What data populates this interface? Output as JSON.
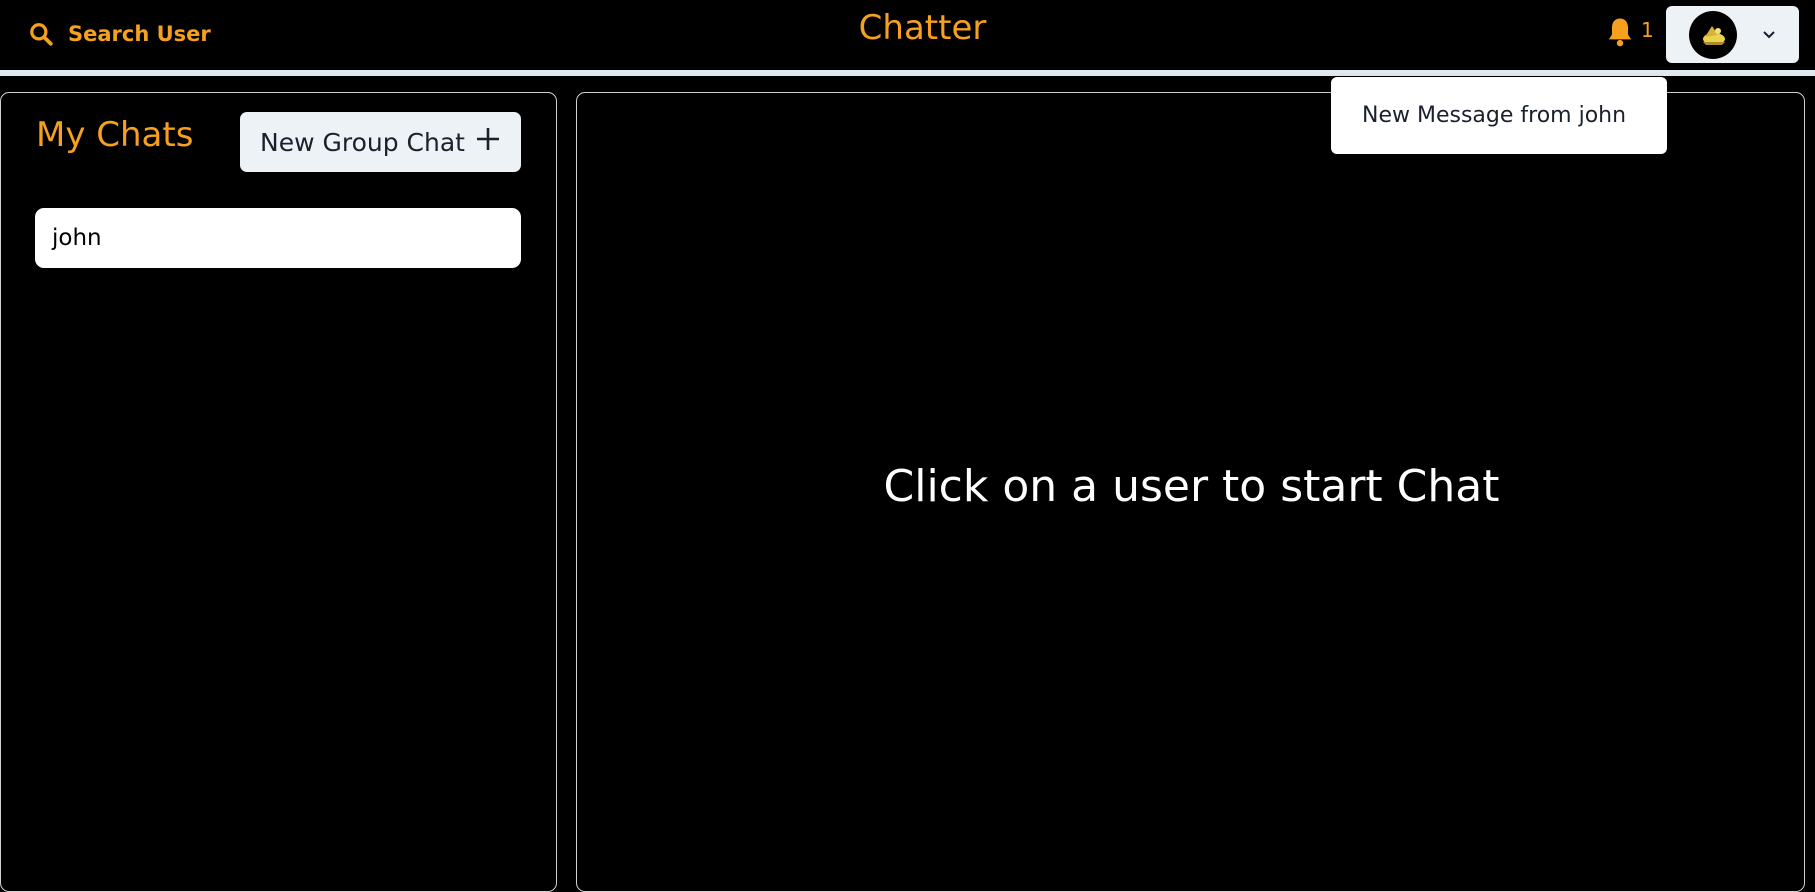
{
  "header": {
    "search_label": "Search User",
    "app_title": "Chatter",
    "notification_count": "1",
    "search_icon": "search-icon",
    "bell_icon": "bell-icon",
    "chevron_icon": "chevron-down-icon"
  },
  "notifications": {
    "items": [
      {
        "label": "New Message from john"
      }
    ]
  },
  "sidebar": {
    "title": "My Chats",
    "new_group_label": "New Group Chat",
    "chats": [
      {
        "name": "john"
      }
    ]
  },
  "main": {
    "empty_message": "Click on a user to start Chat"
  },
  "colors": {
    "accent": "#f6a020",
    "background": "#000000",
    "button_bg": "#edf2f7",
    "panel_border": "#d0d0d0"
  }
}
